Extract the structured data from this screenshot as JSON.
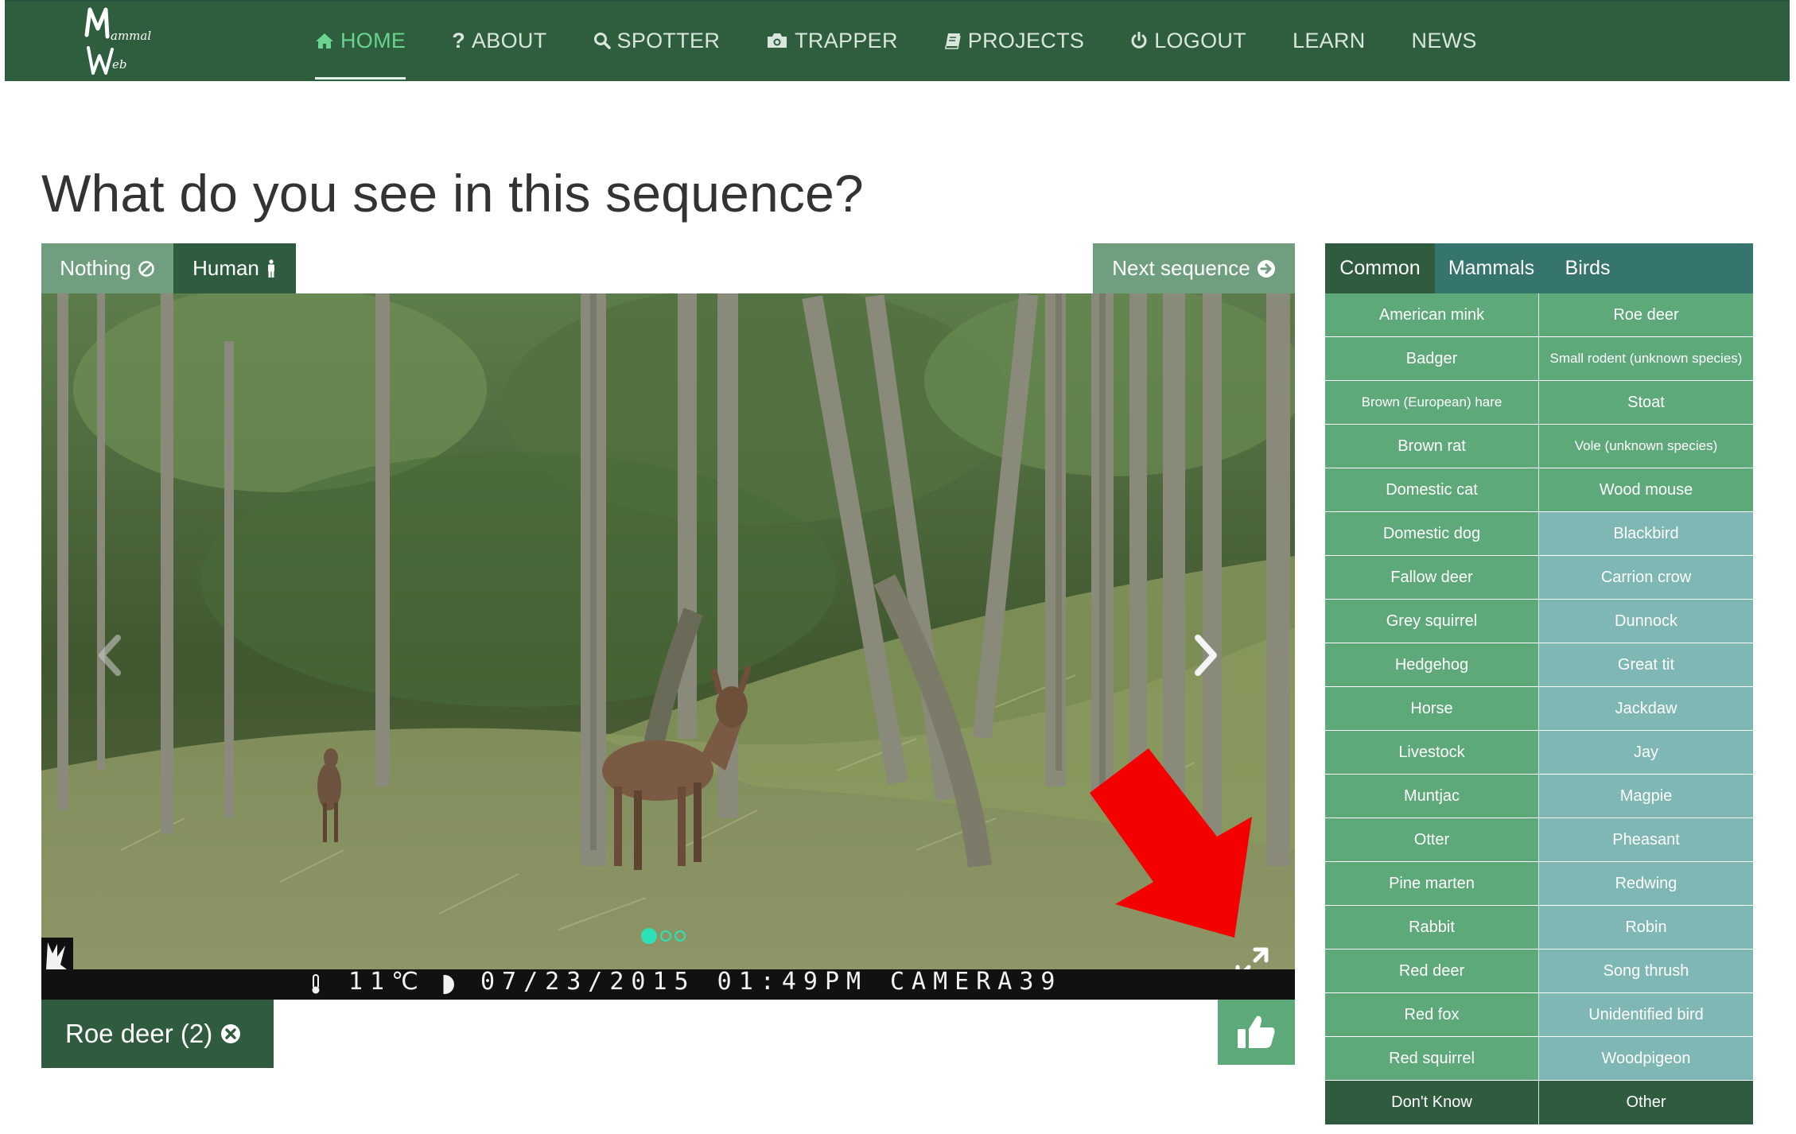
{
  "nav": {
    "logo_text": "Mammal Web",
    "items": [
      {
        "label": "HOME",
        "icon": "home-icon",
        "active": true
      },
      {
        "label": "ABOUT",
        "icon": "question-icon",
        "active": false
      },
      {
        "label": "SPOTTER",
        "icon": "search-icon",
        "active": false
      },
      {
        "label": "TRAPPER",
        "icon": "camera-icon",
        "active": false
      },
      {
        "label": "PROJECTS",
        "icon": "book-icon",
        "active": false
      },
      {
        "label": "LOGOUT",
        "icon": "power-icon",
        "active": false
      },
      {
        "label": "LEARN",
        "icon": "",
        "active": false
      },
      {
        "label": "NEWS",
        "icon": "",
        "active": false
      }
    ]
  },
  "main": {
    "title": "What do you see in this sequence?",
    "nothing_label": "Nothing",
    "human_label": "Human",
    "next_label": "Next sequence"
  },
  "viewer": {
    "temperature": "11℃",
    "datetime": "07/23/2015 01:49PM",
    "camera": "CAMERA39",
    "slides_total": 3,
    "slide_active": 1
  },
  "selection": {
    "tag_label": "Roe deer (2)"
  },
  "panel": {
    "tabs": [
      {
        "label": "Common",
        "active": true
      },
      {
        "label": "Mammals",
        "active": false
      },
      {
        "label": "Birds",
        "active": false
      }
    ],
    "species": [
      {
        "label": "American mink",
        "kind": "mammal"
      },
      {
        "label": "Roe deer",
        "kind": "mammal"
      },
      {
        "label": "Badger",
        "kind": "mammal"
      },
      {
        "label": "Small rodent (unknown species)",
        "kind": "mammal",
        "small": true
      },
      {
        "label": "Brown (European) hare",
        "kind": "mammal",
        "small": true
      },
      {
        "label": "Stoat",
        "kind": "mammal"
      },
      {
        "label": "Brown rat",
        "kind": "mammal"
      },
      {
        "label": "Vole (unknown species)",
        "kind": "mammal",
        "small": true
      },
      {
        "label": "Domestic cat",
        "kind": "mammal"
      },
      {
        "label": "Wood mouse",
        "kind": "mammal"
      },
      {
        "label": "Domestic dog",
        "kind": "mammal"
      },
      {
        "label": "Blackbird",
        "kind": "bird"
      },
      {
        "label": "Fallow deer",
        "kind": "mammal"
      },
      {
        "label": "Carrion crow",
        "kind": "bird"
      },
      {
        "label": "Grey squirrel",
        "kind": "mammal"
      },
      {
        "label": "Dunnock",
        "kind": "bird"
      },
      {
        "label": "Hedgehog",
        "kind": "mammal"
      },
      {
        "label": "Great tit",
        "kind": "bird"
      },
      {
        "label": "Horse",
        "kind": "mammal"
      },
      {
        "label": "Jackdaw",
        "kind": "bird"
      },
      {
        "label": "Livestock",
        "kind": "mammal"
      },
      {
        "label": "Jay",
        "kind": "bird"
      },
      {
        "label": "Muntjac",
        "kind": "mammal"
      },
      {
        "label": "Magpie",
        "kind": "bird"
      },
      {
        "label": "Otter",
        "kind": "mammal"
      },
      {
        "label": "Pheasant",
        "kind": "bird"
      },
      {
        "label": "Pine marten",
        "kind": "mammal"
      },
      {
        "label": "Redwing",
        "kind": "bird"
      },
      {
        "label": "Rabbit",
        "kind": "mammal"
      },
      {
        "label": "Robin",
        "kind": "bird"
      },
      {
        "label": "Red deer",
        "kind": "mammal"
      },
      {
        "label": "Song thrush",
        "kind": "bird"
      },
      {
        "label": "Red fox",
        "kind": "mammal"
      },
      {
        "label": "Unidentified bird",
        "kind": "bird"
      },
      {
        "label": "Red squirrel",
        "kind": "mammal"
      },
      {
        "label": "Woodpigeon",
        "kind": "bird"
      }
    ],
    "footer": [
      {
        "label": "Don't Know"
      },
      {
        "label": "Other"
      }
    ]
  },
  "colors": {
    "nav_bg": "#2e5e3e",
    "accent_green": "#5ea97a",
    "bird_teal": "#7eb7b4",
    "dark_green": "#2f5c3e",
    "arrow_red": "#f40000"
  }
}
